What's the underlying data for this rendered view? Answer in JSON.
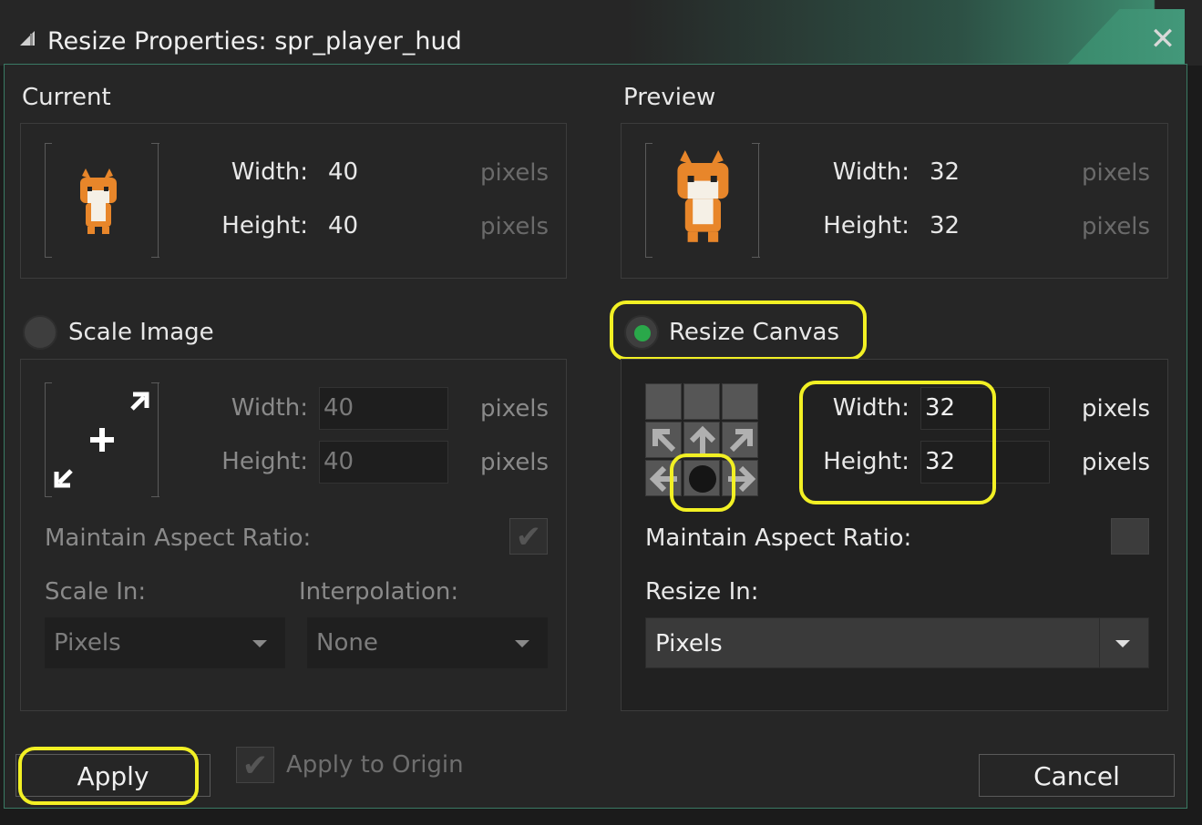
{
  "window": {
    "title": "Resize Properties: spr_player_hud",
    "close_icon": "close-icon"
  },
  "current": {
    "heading": "Current",
    "width_label": "Width:",
    "width_value": "40",
    "height_label": "Height:",
    "height_value": "40",
    "unit": "pixels"
  },
  "preview": {
    "heading": "Preview",
    "width_label": "Width:",
    "width_value": "32",
    "height_label": "Height:",
    "height_value": "32",
    "unit": "pixels"
  },
  "scale_image": {
    "label": "Scale Image",
    "selected": false,
    "width_label": "Width:",
    "width_value": "40",
    "height_label": "Height:",
    "height_value": "40",
    "unit": "pixels",
    "maintain_aspect_label": "Maintain Aspect Ratio:",
    "maintain_aspect_checked": true,
    "scale_in_label": "Scale In:",
    "scale_in_value": "Pixels",
    "interpolation_label": "Interpolation:",
    "interpolation_value": "None"
  },
  "resize_canvas": {
    "label": "Resize Canvas",
    "selected": true,
    "width_label": "Width:",
    "width_value": "32",
    "height_label": "Height:",
    "height_value": "32",
    "unit": "pixels",
    "maintain_aspect_label": "Maintain Aspect Ratio:",
    "maintain_aspect_checked": false,
    "resize_in_label": "Resize In:",
    "resize_in_value": "Pixels",
    "anchor": "center"
  },
  "footer": {
    "apply_label": "Apply",
    "apply_to_origin_label": "Apply to Origin",
    "apply_to_origin_checked": true,
    "cancel_label": "Cancel"
  },
  "colors": {
    "accent": "#2aa84a",
    "highlight": "#f2f024",
    "background": "#262626"
  }
}
